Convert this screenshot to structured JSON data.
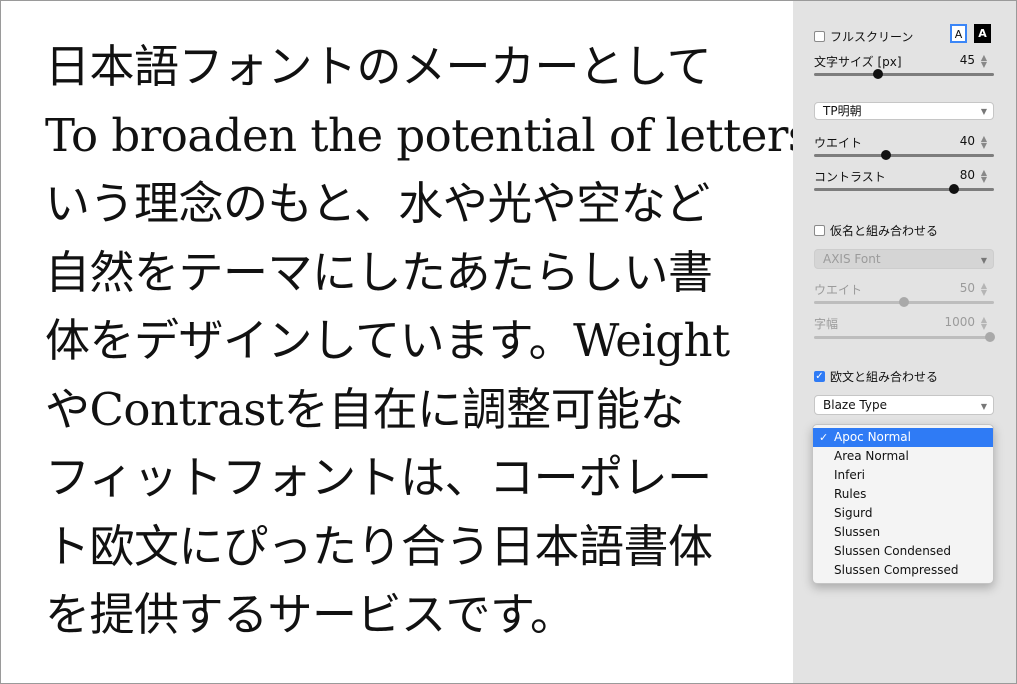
{
  "sample_text": {
    "lines": [
      "日本語フォントのメーカーとして",
      "To broaden the potential of lettersと",
      "いう理念のもと、水や光や空など",
      "自然をテーマにしたあたらしい書",
      "体をデザインしています。Weight",
      "やContrastを自在に調整可能な",
      "フィットフォントは、コーポレー",
      "ト欧文にぴったり合う日本語書体",
      "を提供するサービスです。"
    ]
  },
  "panel": {
    "fullscreen_label": "フルスクリーン",
    "theme_light": "A",
    "theme_dark": "A",
    "font_size": {
      "label": "文字サイズ [px]",
      "value": "45",
      "level": 0.38
    },
    "font_select": "TP明朝",
    "weight": {
      "label": "ウエイト",
      "value": "40",
      "level": 0.38
    },
    "contrast": {
      "label": "コントラスト",
      "value": "80",
      "level": 0.8
    },
    "kana": {
      "label": "仮名と組み合わせる",
      "font": "AXIS Font",
      "weight_label": "ウエイト",
      "weight_value": "50",
      "weight_level": 0.5,
      "width_label": "字幅",
      "width_value": "1000",
      "width_level": 1.0
    },
    "latin": {
      "label": "欧文と組み合わせる",
      "font": "Blaze Type"
    },
    "latin_options": [
      "Apoc Normal",
      "Area Normal",
      "Inferi",
      "Rules",
      "Sigurd",
      "Slussen",
      "Slussen Condensed",
      "Slussen Compressed"
    ],
    "selected_option": "Apoc Normal",
    "colors": {
      "accent": "#2f7bf5",
      "panel_bg": "#e3e3e3"
    }
  }
}
